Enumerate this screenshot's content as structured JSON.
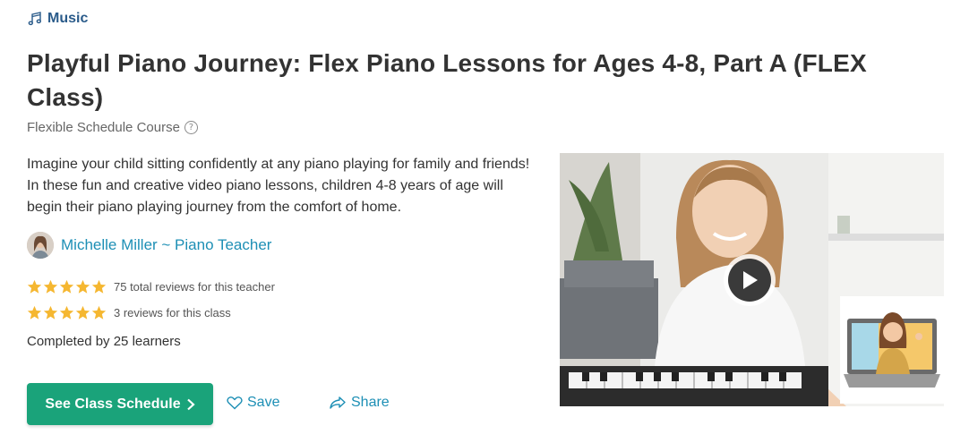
{
  "category": {
    "icon": "music-note-icon",
    "label": "Music"
  },
  "title": "Playful Piano Journey: Flex Piano Lessons for Ages 4-8, Part A (FLEX Class)",
  "subtitle": {
    "text": "Flexible Schedule Course",
    "help_icon": "question-circle-icon"
  },
  "description": "Imagine your child sitting confidently at any piano playing for family and friends! In these fun and creative video piano lessons, children 4-8 years of age will begin their piano playing journey from the comfort of home.",
  "teacher": {
    "name": "Michelle Miller ~ Piano Teacher"
  },
  "ratings": [
    {
      "stars": 5,
      "text": "75 total reviews for this teacher"
    },
    {
      "stars": 5,
      "text": "3 reviews for this class"
    }
  ],
  "completed": "Completed by 25 learners",
  "actions": {
    "schedule_label": "See Class Schedule",
    "save_label": "Save",
    "share_label": "Share"
  },
  "colors": {
    "accent_green": "#1aa37a",
    "link_blue": "#1d8fb5",
    "category_blue": "#2a5b8a",
    "star_gold": "#f5b731"
  }
}
